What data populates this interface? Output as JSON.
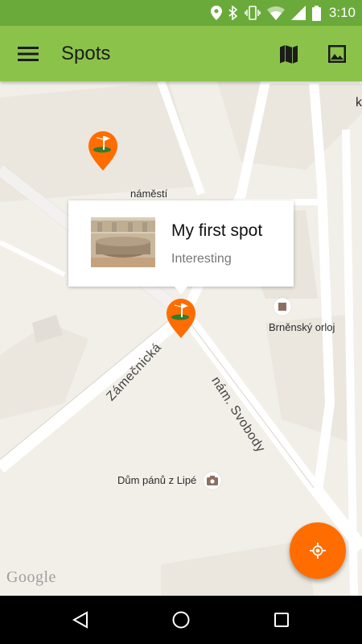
{
  "status_bar": {
    "time": "3:10",
    "icons": [
      "location-icon",
      "bluetooth-icon",
      "vibrate-icon",
      "wifi-icon",
      "signal-icon",
      "battery-icon"
    ]
  },
  "app_bar": {
    "title": "Spots",
    "background_color": "#8bc34a",
    "actions": [
      "map-icon",
      "gallery-icon"
    ]
  },
  "map": {
    "labels": {
      "namesti": "náměstí",
      "orloj": "Brněnský orloj",
      "dum": "Dům pánů z Lipé",
      "edge_k": "k"
    },
    "streets": {
      "zamecnicka": "Zámečnická",
      "nam_svobody": "nám. Svobody"
    },
    "attribution": "Google"
  },
  "info_window": {
    "title": "My first spot",
    "subtitle": "Interesting"
  },
  "fab": {
    "icon": "my-location-icon",
    "color": "#ff6d00"
  },
  "nav_bar": {
    "buttons": [
      "back-icon",
      "home-icon",
      "recents-icon"
    ]
  }
}
